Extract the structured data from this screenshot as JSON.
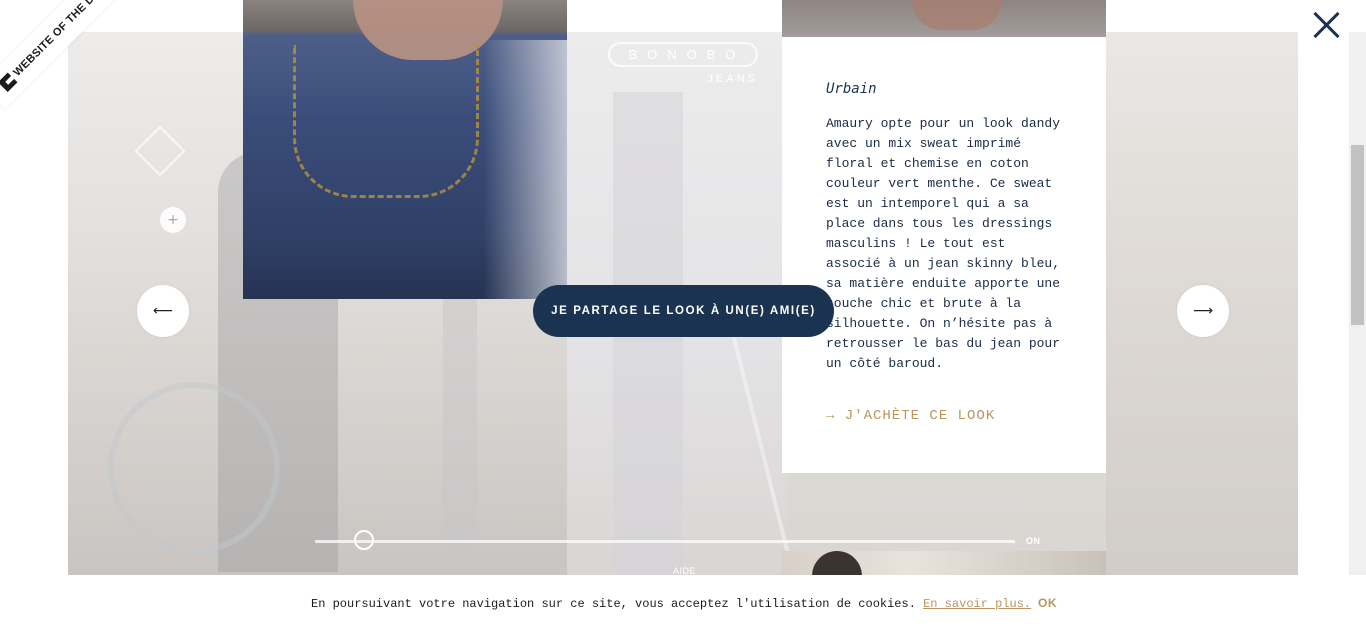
{
  "badge": {
    "label": "WEBSITE OF THE DAY"
  },
  "brand": {
    "logo_text": "BONOBO",
    "sub_text": "JEANS"
  },
  "controls": {
    "prev_arrow": "⟵",
    "next_arrow": "⟶",
    "plus": "+"
  },
  "share": {
    "label": "JE PARTAGE LE LOOK À UN(E) AMI(E)"
  },
  "card": {
    "title": "Urbain",
    "description": "Amaury opte pour un look dandy avec un mix sweat imprimé floral et chemise en coton couleur vert menthe. Ce sweat est un intemporel qui a sa place dans tous les dressings masculins ! Le tout est associé à un jean skinny bleu, sa matière enduite apporte une touche chic et brute à la silhouette. On n’hésite pas à retrousser le bas du jean pour un côté baroud.",
    "link_label": "→ J'ACHÈTE CE LOOK"
  },
  "slider": {
    "label": "ON",
    "value_fraction": 0.07
  },
  "help": {
    "label": "AIDE"
  },
  "cookie": {
    "text": "En poursuivant votre navigation sur ce site, vous acceptez l'utilisation de cookies.",
    "link_label": "En savoir plus.",
    "ok_label": "OK"
  },
  "colors": {
    "navy": "#1a3350",
    "gold": "#b8965e"
  },
  "icons": [
    "close-icon",
    "arrow-left-icon",
    "arrow-right-icon",
    "plus-icon",
    "diamond-icon"
  ]
}
